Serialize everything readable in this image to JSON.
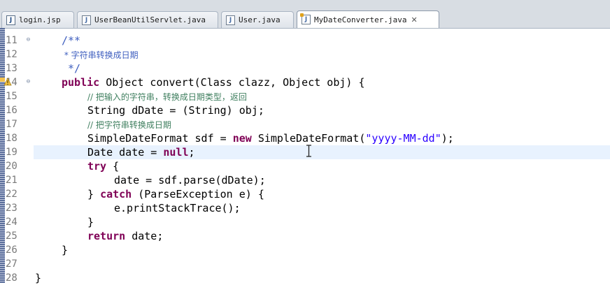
{
  "tabs": [
    {
      "label": "login.jsp",
      "icon": "jsp-file-icon"
    },
    {
      "label": "UserBeanUtilServlet.java",
      "icon": "java-file-icon"
    },
    {
      "label": "User.java",
      "icon": "java-file-icon"
    },
    {
      "label": "MyDateConverter.java",
      "icon": "java-file-icon",
      "active": true,
      "close": "✕"
    }
  ],
  "editor": {
    "lines": [
      {
        "num": "11",
        "text": "/**"
      },
      {
        "num": "12",
        "text": " * 字符串转换成日期"
      },
      {
        "num": "13",
        "text": " */"
      },
      {
        "num": "14",
        "text": "public Object convert(Class clazz, Object obj) {"
      },
      {
        "num": "15",
        "text": "// 把输入的字符串，转换成日期类型，返回"
      },
      {
        "num": "16",
        "text": "String dDate = (String) obj;"
      },
      {
        "num": "17",
        "text": "// 把字符串转换成日期"
      },
      {
        "num": "18",
        "text": "SimpleDateFormat sdf = new SimpleDateFormat(\"yyyy-MM-dd\");"
      },
      {
        "num": "19",
        "text": "Date date = null;"
      },
      {
        "num": "20",
        "text": "try {"
      },
      {
        "num": "21",
        "text": "date = sdf.parse(dDate);"
      },
      {
        "num": "22",
        "text": "} catch (ParseException e) {"
      },
      {
        "num": "23",
        "text": "e.printStackTrace();"
      },
      {
        "num": "24",
        "text": "}"
      },
      {
        "num": "25",
        "text": "return date;"
      },
      {
        "num": "26",
        "text": "}"
      },
      {
        "num": "27",
        "text": ""
      },
      {
        "num": "28",
        "text": "}"
      }
    ],
    "current_line": "19",
    "colors": {
      "keyword": "#7f0055",
      "javadoc": "#3f5fbf",
      "comment": "#3f7f5f",
      "string": "#2a00ff",
      "current_line_bg": "#e8f2fe"
    }
  }
}
